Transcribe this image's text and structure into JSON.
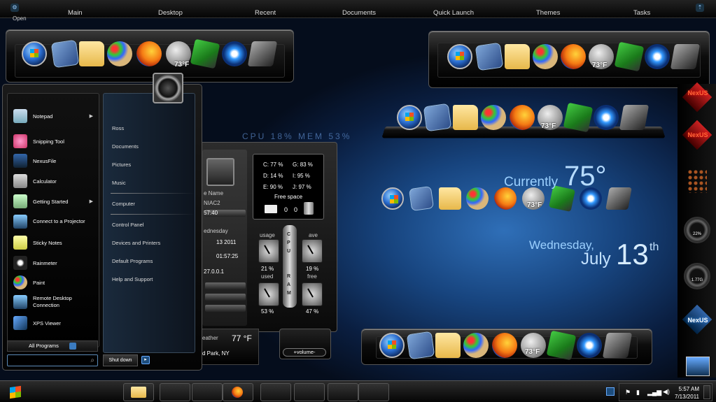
{
  "top_menu": {
    "items": [
      "Main",
      "Desktop",
      "Recent",
      "Documents",
      "Quick Launch",
      "Themes",
      "Tasks"
    ],
    "open_label": "Open"
  },
  "dock": {
    "weather_temp": "73°F",
    "icons": [
      "windows-orb-icon",
      "dlgfo-icon",
      "folder-icon",
      "paint-palette-icon",
      "firefox-icon",
      "moon-weather-icon",
      "tweak-icon",
      "rocketdock-icon",
      "cube-icon"
    ]
  },
  "start_menu": {
    "programs": [
      {
        "label": "Notepad",
        "has_submenu": true
      },
      {
        "label": "Snipping Tool",
        "has_submenu": false
      },
      {
        "label": "NexusFile",
        "has_submenu": false
      },
      {
        "label": "Calculator",
        "has_submenu": false
      },
      {
        "label": "Getting Started",
        "has_submenu": true
      },
      {
        "label": "Connect to a Projector",
        "has_submenu": false
      },
      {
        "label": "Sticky Notes",
        "has_submenu": false
      },
      {
        "label": "Rainmeter",
        "has_submenu": false
      },
      {
        "label": "Paint",
        "has_submenu": false
      },
      {
        "label": "Remote Desktop Connection",
        "has_submenu": false
      },
      {
        "label": "XPS Viewer",
        "has_submenu": false
      }
    ],
    "right_links": [
      "Ross",
      "Documents",
      "Pictures",
      "Music",
      "Computer",
      "Control Panel",
      "Devices and Printers",
      "Default Programs",
      "Help and Support"
    ],
    "all_programs": "All Programs",
    "shut_down": "Shut down",
    "submenu_arrow": "▶"
  },
  "sysmon": {
    "name_label": "e Name",
    "machine": "NIAC2",
    "uptime_short": "57:40",
    "day": "ednesday",
    "date_short": "13  2011",
    "time_full": "01:57:25",
    "ip": "27.0.0.1",
    "drives": [
      {
        "label": "C:",
        "pct": "77 %"
      },
      {
        "label": "G:",
        "pct": "83 %"
      },
      {
        "label": "D:",
        "pct": "14 %"
      },
      {
        "label": "I:",
        "pct": "95 %"
      },
      {
        "label": "E:",
        "pct": "90 %"
      },
      {
        "label": "J:",
        "pct": "97 %"
      }
    ],
    "free_space": "Free space",
    "mail_count": "0",
    "trash_count": "0",
    "usage_label": "usage",
    "ave_label": "ave",
    "cpu_used_pct": "21 %",
    "used_label": "used",
    "cpu_free_pct": "19 %",
    "free_label": "free",
    "ram_left_pct": "53 %",
    "ram_right_pct": "47 %",
    "cpu_letters": [
      "C",
      "P",
      "U"
    ],
    "ram_letters": [
      "R",
      "A",
      "M"
    ],
    "weather_label": "eather",
    "weather_temp": "77 °F",
    "weather_location": "d Park, NY",
    "volume": "+volume-"
  },
  "desktop": {
    "cpu_mem": "CPU  18%    MEM  53%",
    "currently_label": "Currently",
    "current_temp": "75°",
    "weekday": "Wednesday,",
    "month": "July",
    "day": "13",
    "day_suffix": "th"
  },
  "sidebar": {
    "nexus_label": "NexUS",
    "gauge_top": "22%",
    "gauge_bottom": "1.77G"
  },
  "taskbar": {
    "time": "5:57 AM",
    "date": "7/13/2011"
  },
  "colors": {
    "accent_blue": "#3b7bbf",
    "text_glow": "#9bd0ff"
  }
}
